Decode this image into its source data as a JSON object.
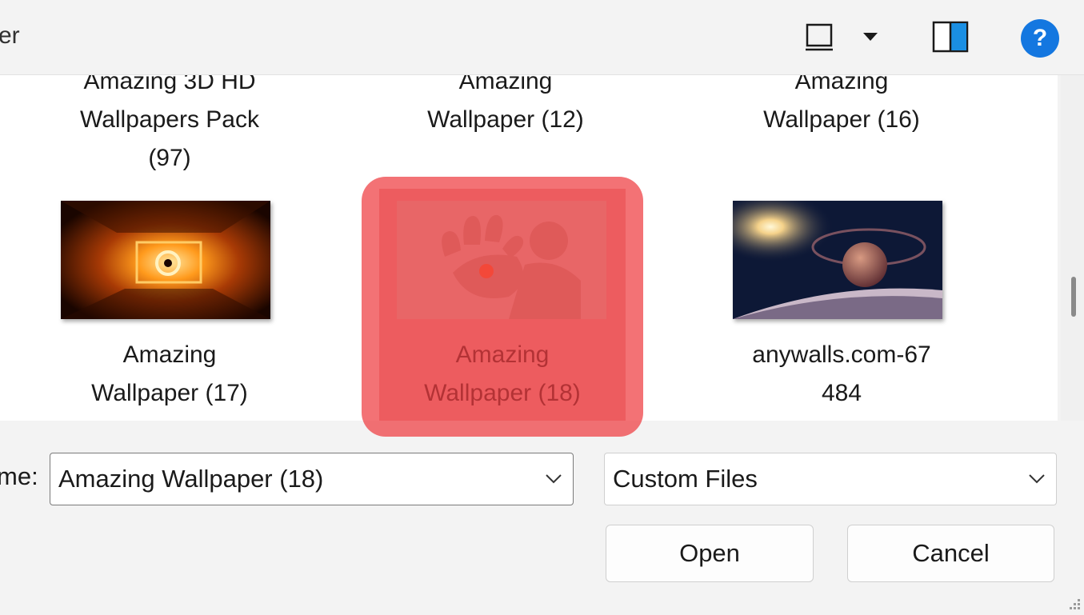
{
  "toolbar": {
    "breadcrumb_fragment": "er",
    "icons": [
      "view-icon",
      "dropdown-arrow-icon",
      "preview-pane-icon",
      "help-icon"
    ],
    "help_glyph": "?"
  },
  "files": [
    {
      "name_lines": [
        "Amazing 3D HD",
        "Wallpapers Pack",
        "(97)"
      ]
    },
    {
      "name_lines": [
        "Amazing",
        "Wallpaper (12)"
      ]
    },
    {
      "name_lines": [
        "Amazing",
        "Wallpaper (16)"
      ]
    },
    {
      "name_lines": [
        "Amazing",
        "Wallpaper (17)"
      ],
      "thumbnail": "light-tunnel-image"
    },
    {
      "name_lines": [
        "Amazing",
        "Wallpaper (18)"
      ],
      "thumbnail": "hand-silhouette-image",
      "selected": true
    },
    {
      "name_lines": [
        "anywalls.com-67",
        "484"
      ],
      "thumbnail": "planet-space-image"
    }
  ],
  "bottom": {
    "filename_label": "me:",
    "filename_value": "Amazing Wallpaper (18)",
    "filetype_value": "Custom Files",
    "open_label": "Open",
    "cancel_label": "Cancel"
  },
  "colors": {
    "highlight": "#ee3c40",
    "help_blue": "#1477e0"
  }
}
